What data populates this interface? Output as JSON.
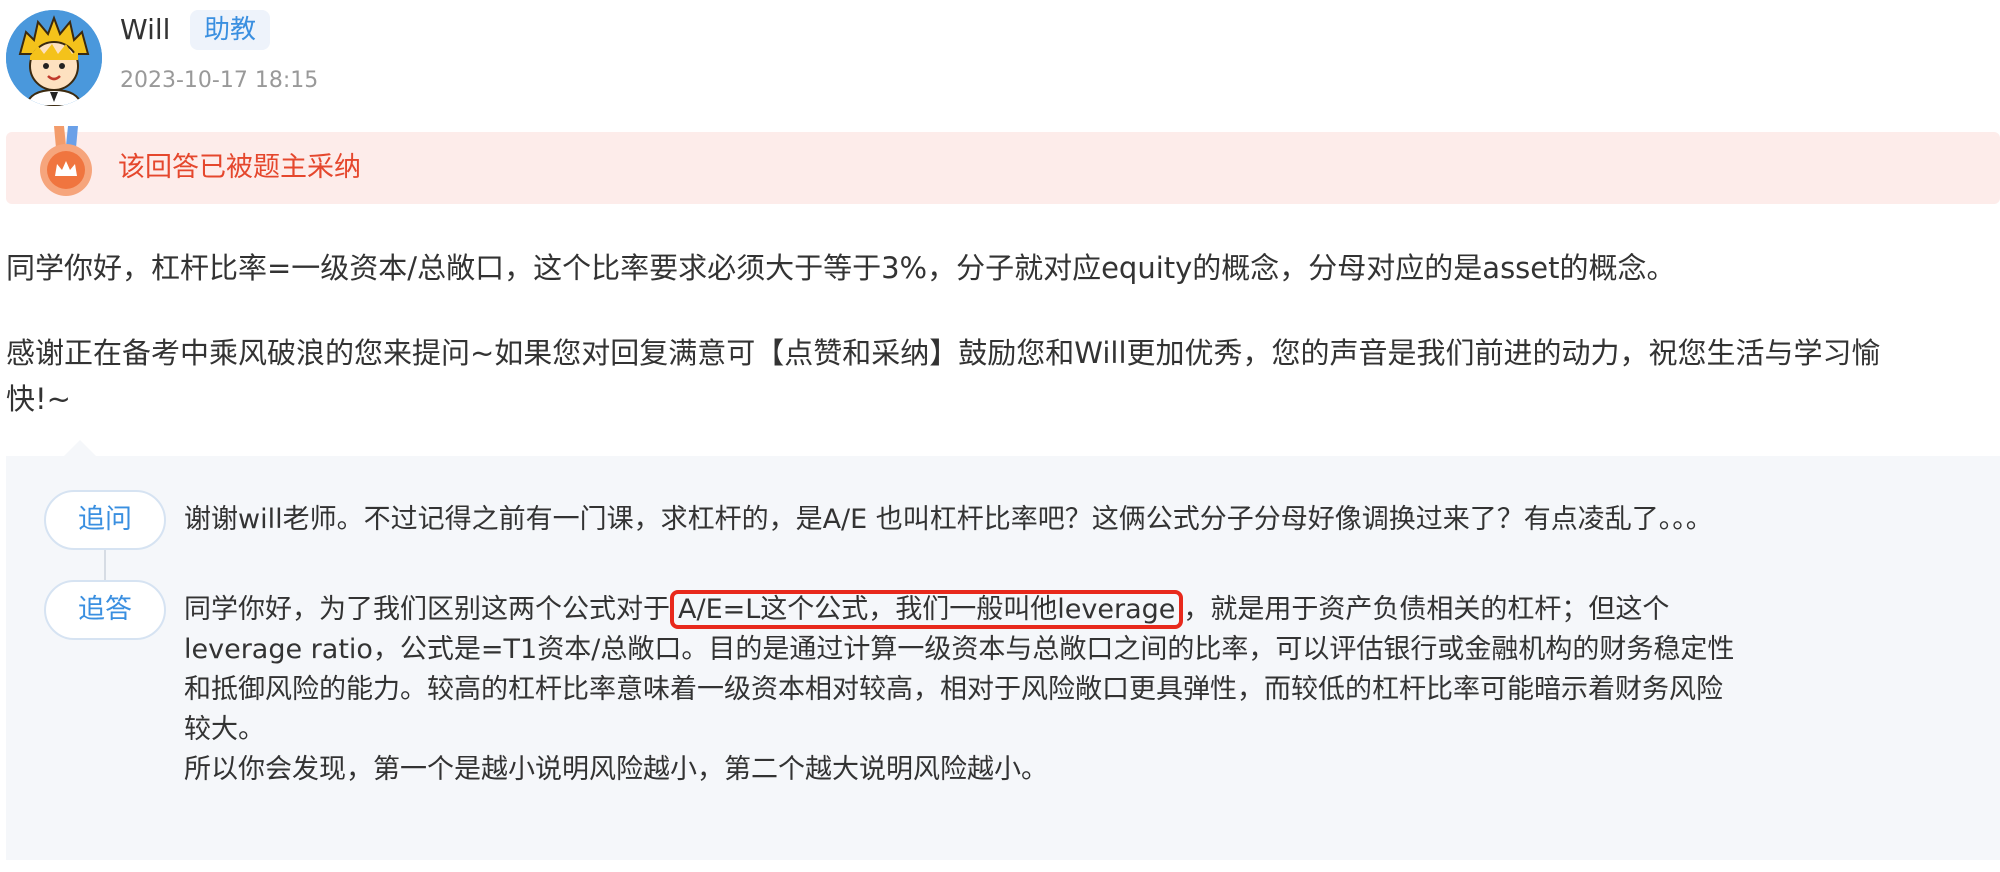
{
  "author": {
    "name": "Will",
    "role": "助教",
    "timestamp": "2023-10-17 18:15"
  },
  "adopted_banner": {
    "icon": "medal-icon",
    "text": "该回答已被题主采纳"
  },
  "answer": {
    "paragraph1": "同学你好，杠杆比率=一级资本/总敞口，这个比率要求必须大于等于3%，分子就对应equity的概念，分母对应的是asset的概念。",
    "paragraph2": "感谢正在备考中乘风破浪的您来提问~如果您对回复满意可【点赞和采纳】鼓励您和Will更加优秀，您的声音是我们前进的动力，祝您生活与学习愉快!~"
  },
  "followup": {
    "ask_label": "追问",
    "ask_text": "谢谢will老师。不过记得之前有一门课，求杠杆的，是A/E 也叫杠杆比率吧？这俩公式分子分母好像调换过来了？有点凌乱了。。。",
    "reply_label": "追答",
    "reply": {
      "line1_before": "同学你好，为了我们区别这两个公式对于",
      "line1_highlight": "A/E=L这个公式，我们一般叫他leverage",
      "line1_after": "，就是用于资产负债相关的杠杆；但这个",
      "line2": "leverage ratio，公式是=T1资本/总敞口。目的是通过计算一级资本与总敞口之间的比率，可以评估银行或金融机构的财务稳定性",
      "line3": "和抵御风险的能力。较高的杠杆比率意味着一级资本相对较高，相对于风险敞口更具弹性，而较低的杠杆比率可能暗示着财务风险",
      "line4": "较大。",
      "line5": "所以你会发现，第一个是越小说明风险越小，第二个越大说明风险越小。"
    }
  },
  "colors": {
    "accent_blue": "#3a8fe0",
    "adopted_red": "#e5472d",
    "banner_bg": "#fdecea",
    "highlight_red": "#e8291c",
    "followup_bg": "#f5f7fa"
  }
}
